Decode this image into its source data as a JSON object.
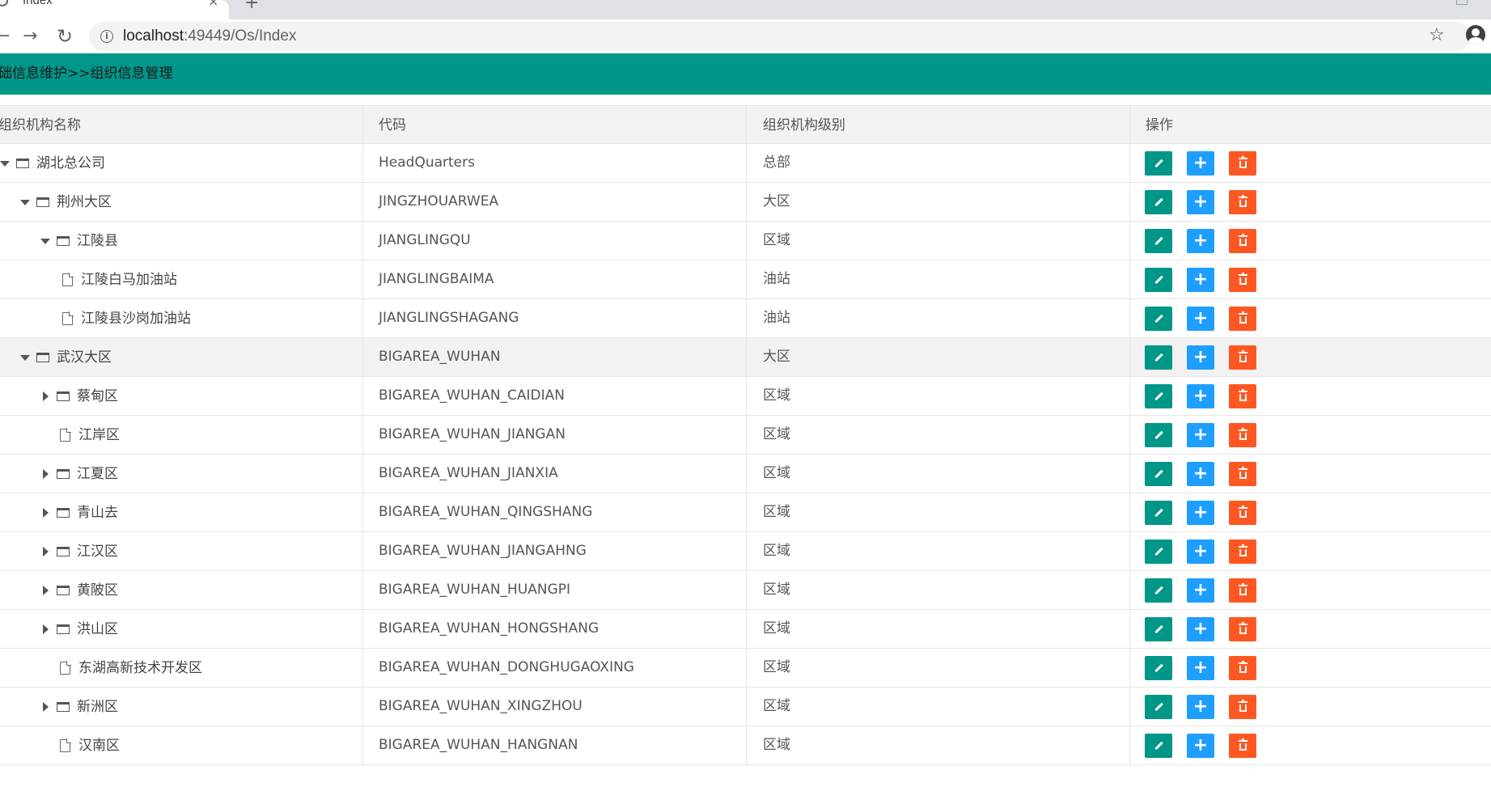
{
  "browser": {
    "tab_title": "Index",
    "tab_close": "×",
    "new_tab": "+",
    "url_host": "localhost",
    "url_rest": ":49449/Os/Index",
    "icons": [
      "back-arrow-icon",
      "forward-arrow-icon",
      "reload-icon",
      "info-icon",
      "star-icon",
      "profile-icon"
    ]
  },
  "header": {
    "breadcrumb": "础信息维护>>组织信息管理",
    "color": "#009688"
  },
  "table": {
    "columns": [
      "组织机构名称",
      "代码",
      "组织机构级别",
      "操作"
    ],
    "rows": [
      {
        "name": "湖北总公司",
        "code": "HeadQuarters",
        "level": "总部",
        "depth": 0,
        "toggle": "down",
        "icon": "folder"
      },
      {
        "name": "荆州大区",
        "code": "JINGZHOUARWEA",
        "level": "大区",
        "depth": 1,
        "toggle": "down",
        "icon": "folder"
      },
      {
        "name": "江陵县",
        "code": "JIANGLINGQU",
        "level": "区域",
        "depth": 2,
        "toggle": "down",
        "icon": "folder"
      },
      {
        "name": "江陵白马加油站",
        "code": "JIANGLINGBAIMA",
        "level": "油站",
        "depth": 3,
        "toggle": "none",
        "icon": "file"
      },
      {
        "name": "江陵县沙岗加油站",
        "code": "JIANGLINGSHAGANG",
        "level": "油站",
        "depth": 3,
        "toggle": "none",
        "icon": "file"
      },
      {
        "name": "武汉大区",
        "code": "BIGAREA_WUHAN",
        "level": "大区",
        "depth": 1,
        "toggle": "down",
        "icon": "folder",
        "highlight": true
      },
      {
        "name": "蔡甸区",
        "code": "BIGAREA_WUHAN_CAIDIAN",
        "level": "区域",
        "depth": 2,
        "toggle": "right",
        "icon": "folder"
      },
      {
        "name": "江岸区",
        "code": "BIGAREA_WUHAN_JIANGAN",
        "level": "区域",
        "depth": 2,
        "toggle": "none",
        "icon": "file"
      },
      {
        "name": "江夏区",
        "code": "BIGAREA_WUHAN_JIANXIA",
        "level": "区域",
        "depth": 2,
        "toggle": "right",
        "icon": "folder"
      },
      {
        "name": "青山去",
        "code": "BIGAREA_WUHAN_QINGSHANG",
        "level": "区域",
        "depth": 2,
        "toggle": "right",
        "icon": "folder"
      },
      {
        "name": "江汉区",
        "code": "BIGAREA_WUHAN_JIANGAHNG",
        "level": "区域",
        "depth": 2,
        "toggle": "right",
        "icon": "folder"
      },
      {
        "name": "黄陂区",
        "code": "BIGAREA_WUHAN_HUANGPI",
        "level": "区域",
        "depth": 2,
        "toggle": "right",
        "icon": "folder"
      },
      {
        "name": "洪山区",
        "code": "BIGAREA_WUHAN_HONGSHANG",
        "level": "区域",
        "depth": 2,
        "toggle": "right",
        "icon": "folder"
      },
      {
        "name": "东湖高新技术开发区",
        "code": "BIGAREA_WUHAN_DONGHUGAOXING",
        "level": "区域",
        "depth": 2,
        "toggle": "none",
        "icon": "file"
      },
      {
        "name": "新洲区",
        "code": "BIGAREA_WUHAN_XINGZHOU",
        "level": "区域",
        "depth": 2,
        "toggle": "right",
        "icon": "folder"
      },
      {
        "name": "汉南区",
        "code": "BIGAREA_WUHAN_HANGNAN",
        "level": "区域",
        "depth": 2,
        "toggle": "none",
        "icon": "file"
      }
    ],
    "action_colors": {
      "edit": "#009688",
      "add": "#1e9fff",
      "delete": "#ff5722"
    },
    "action_icons": {
      "edit": "pencil-icon",
      "add": "plus-icon",
      "delete": "trash-icon"
    },
    "add_symbol": "+"
  }
}
